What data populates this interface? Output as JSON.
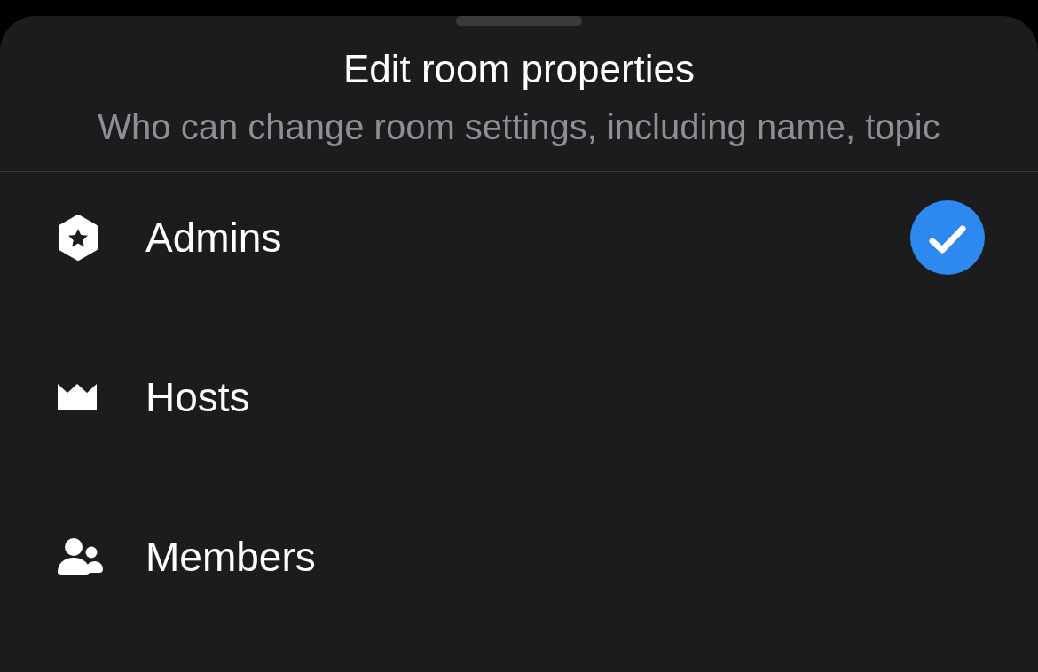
{
  "sheet": {
    "title": "Edit room properties",
    "subtitle": "Who can change room settings, including name, topic"
  },
  "options": [
    {
      "kind": "admins",
      "label": "Admins",
      "selected": true
    },
    {
      "kind": "hosts",
      "label": "Hosts",
      "selected": false
    },
    {
      "kind": "members",
      "label": "Members",
      "selected": false
    }
  ]
}
